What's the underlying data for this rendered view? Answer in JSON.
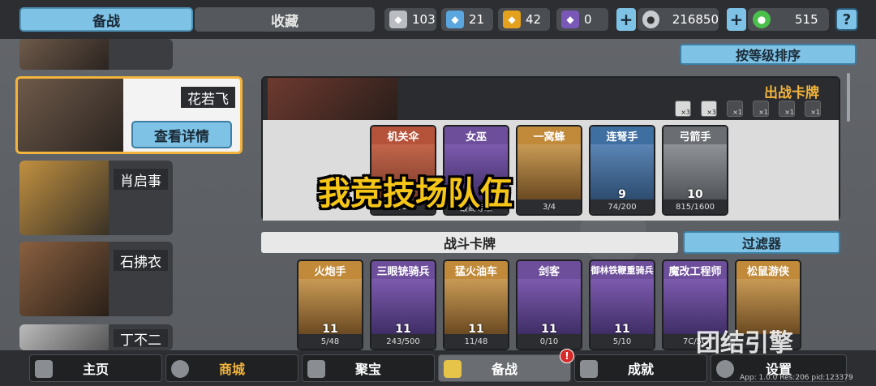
{
  "tabs": {
    "prep": "备战",
    "collection": "收藏"
  },
  "resources": [
    {
      "icon": "silver-shield-icon",
      "value": "103",
      "color": "#b9bcc0"
    },
    {
      "icon": "blue-crystal-icon",
      "value": "21",
      "color": "#5aa7e0"
    },
    {
      "icon": "gold-shield-icon",
      "value": "42",
      "color": "#e3a11e"
    },
    {
      "icon": "purple-mask-icon",
      "value": "0",
      "color": "#7a58b8"
    },
    {
      "icon": "silver-coin-icon",
      "value": "216850",
      "color": "#c9ccd0"
    },
    {
      "icon": "green-gem-icon",
      "value": "515",
      "color": "#4bbf4b"
    }
  ],
  "help_label": "?",
  "plus_label": "+",
  "heroes": [
    {
      "name": "花若飞",
      "selected": true
    },
    {
      "name": "肖启事"
    },
    {
      "name": "石拂衣"
    },
    {
      "name": "丁不二"
    }
  ],
  "detail_button": "查看详情",
  "sort_button": "按等级排序",
  "battle_panel_title": "出战卡牌",
  "slot_labels": [
    "×3",
    "×3",
    "×1",
    "×1",
    "×1",
    "×1"
  ],
  "battle_cards": [
    {
      "name": "机关伞",
      "footer": "0/10",
      "level": ""
    },
    {
      "name": "女巫",
      "footer": "最高等级",
      "level": ""
    },
    {
      "name": "一窝蜂",
      "footer": "3/4",
      "level": ""
    },
    {
      "name": "连弩手",
      "footer": "74/200",
      "level": "9"
    },
    {
      "name": "弓箭手",
      "footer": "815/1600",
      "level": "10"
    }
  ],
  "overlay_text": "我竞技场队伍",
  "fight_cards_label": "战斗卡牌",
  "filter_button": "过滤器",
  "fight_cards": [
    {
      "name": "火炮手",
      "level": "11",
      "footer": "5/48"
    },
    {
      "name": "三眼铳骑兵",
      "level": "11",
      "footer": "243/500"
    },
    {
      "name": "猛火油车",
      "level": "11",
      "footer": "11/48"
    },
    {
      "name": "剑客",
      "level": "11",
      "footer": "0/10"
    },
    {
      "name": "御林铁鞭重骑兵",
      "level": "11",
      "footer": "5/10"
    },
    {
      "name": "魔改工程师",
      "level": "",
      "footer": "7C/5C"
    },
    {
      "name": "松鼠游侠",
      "level": "",
      "footer": ""
    }
  ],
  "nav": [
    {
      "label": "主页"
    },
    {
      "label": "商城"
    },
    {
      "label": "聚宝"
    },
    {
      "label": "备战"
    },
    {
      "label": "成就"
    },
    {
      "label": "设置"
    }
  ],
  "badge": "!",
  "watermark": "团结引擎",
  "version": "App: 1.0.0 Res:206 pid:123379"
}
